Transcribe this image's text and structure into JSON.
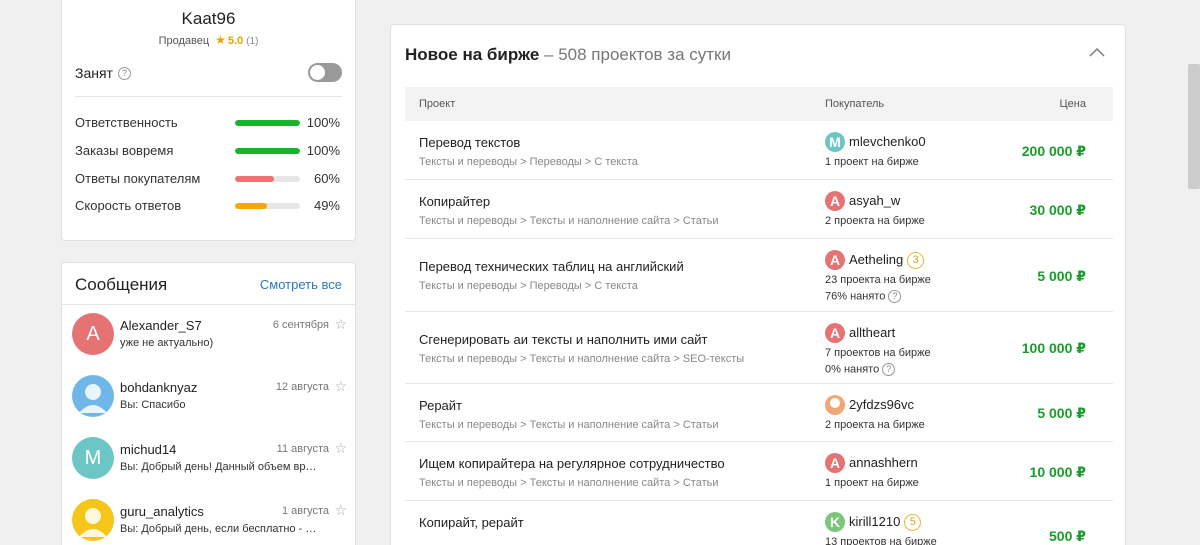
{
  "profile": {
    "username": "Kaat96",
    "role": "Продавец",
    "rating": "5.0",
    "rating_count": "(1)",
    "busy_label": "Занят",
    "busy_help": "?",
    "stats": [
      {
        "label": "Ответственность",
        "value": "100%",
        "fraction": 1.0,
        "color": "#17b42b"
      },
      {
        "label": "Заказы вовремя",
        "value": "100%",
        "fraction": 1.0,
        "color": "#17b42b"
      },
      {
        "label": "Ответы покупателям",
        "value": "60%",
        "fraction": 0.6,
        "color": "#f17272"
      },
      {
        "label": "Скорость ответов",
        "value": "49%",
        "fraction": 0.49,
        "color": "#f5a800"
      }
    ]
  },
  "messages": {
    "title": "Сообщения",
    "see_all": "Смотреть все",
    "items": [
      {
        "user": "Alexander_S7",
        "date": "6 сентября",
        "text": "уже не актуально)",
        "initial": "A",
        "color": "#e57373"
      },
      {
        "user": "bohdanknyaz",
        "date": "12 августа",
        "text": "Вы: Спасибо",
        "initial": "",
        "color": "#6fb7e8"
      },
      {
        "user": "michud14",
        "date": "11 августа",
        "text": "Вы: Добрый день! Данный объем вре...",
        "initial": "M",
        "color": "#6dc6c6"
      },
      {
        "user": "guru_analytics",
        "date": "1 августа",
        "text": "Вы: Добрый день, если бесплатно - си...",
        "initial": "",
        "color": "#f5c518"
      }
    ]
  },
  "exchange": {
    "title": "Новое на бирже",
    "subtitle": "– 508 проектов за сутки",
    "columns": {
      "project": "Проект",
      "buyer": "Покупатель",
      "price": "Цена"
    },
    "rows": [
      {
        "title": "Перевод текстов",
        "category": "Тексты и переводы > Переводы > С текста",
        "buyer": "mlevchenko0",
        "initial": "M",
        "avatar_color": "#6dc6c6",
        "level": "",
        "projects": "1 проект на бирже",
        "hired": "",
        "price": "200 000 ₽"
      },
      {
        "title": "Копирайтер",
        "category": "Тексты и переводы > Тексты и наполнение сайта > Статьи",
        "buyer": "asyah_w",
        "initial": "A",
        "avatar_color": "#e57373",
        "level": "",
        "projects": "2 проекта на бирже",
        "hired": "",
        "price": "30 000 ₽"
      },
      {
        "title": "Перевод технических таблиц на английский",
        "category": "Тексты и переводы > Переводы > С текста",
        "buyer": "Aetheling",
        "initial": "A",
        "avatar_color": "#e57373",
        "level": "3",
        "projects": "23 проекта на бирже",
        "hired": "76% нанято",
        "price": "5 000 ₽"
      },
      {
        "title": "Сгенерировать аи тексты и наполнить ими сайт",
        "category": "Тексты и переводы > Тексты и наполнение сайта > SEO-тексты",
        "buyer": "alltheart",
        "initial": "A",
        "avatar_color": "#e57373",
        "level": "",
        "projects": "7 проектов на бирже",
        "hired": "0% нанято",
        "price": "100 000 ₽"
      },
      {
        "title": "Рерайт",
        "category": "Тексты и переводы > Тексты и наполнение сайта > Статьи",
        "buyer": "2yfdzs96vc",
        "initial": "",
        "avatar_color": "#f0a878",
        "level": "",
        "projects": "2 проекта на бирже",
        "hired": "",
        "price": "5 000 ₽"
      },
      {
        "title": "Ищем копирайтера на регулярное сотрудничество",
        "category": "Тексты и переводы > Тексты и наполнение сайта > Статьи",
        "buyer": "annashhern",
        "initial": "A",
        "avatar_color": "#e57373",
        "level": "",
        "projects": "1 проект на бирже",
        "hired": "",
        "price": "10 000 ₽"
      },
      {
        "title": "Копирайт, рерайт",
        "category": "",
        "buyer": "kirill1210",
        "initial": "K",
        "avatar_color": "#7bc67b",
        "level": "5",
        "projects": "13 проектов на бирже",
        "hired": "",
        "price": "500 ₽"
      }
    ]
  }
}
